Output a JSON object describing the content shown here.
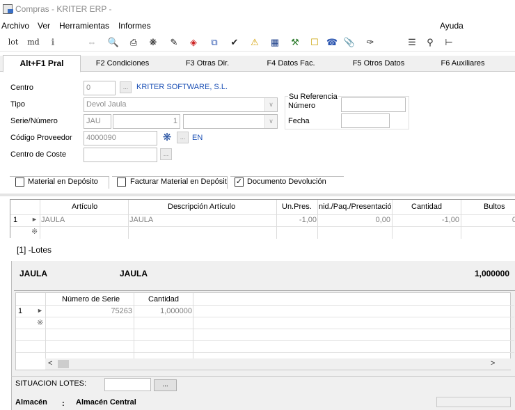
{
  "window": {
    "title": "Compras - KRITER ERP -"
  },
  "menu": {
    "archivo": "Archivo",
    "ver": "Ver",
    "herramientas": "Herramientas",
    "informes": "Informes",
    "ayuda": "Ayuda"
  },
  "toolbar": {
    "lot": "lot",
    "md": "md"
  },
  "tabs": [
    {
      "label": "Alt+F1 Pral"
    },
    {
      "label": "F2 Condiciones"
    },
    {
      "label": "F3 Otras Dir."
    },
    {
      "label": "F4 Datos Fac."
    },
    {
      "label": "F5 Otros Datos"
    },
    {
      "label": "F6 Auxiliares"
    }
  ],
  "form": {
    "centro_label": "Centro",
    "centro_value": "0",
    "centro_name": "KRITER SOFTWARE, S.L.",
    "tipo_label": "Tipo",
    "tipo_value": "Devol Jaula",
    "serie_label": "Serie/Número",
    "serie_value": "JAU",
    "numero_value": "1",
    "proveedor_label": "Código Proveedor",
    "proveedor_value": "4000090",
    "proveedor_lang": "EN",
    "coste_label": "Centro de Coste",
    "ref_title": "Su Referencia",
    "ref_numero_label": "Número",
    "ref_fecha_label": "Fecha"
  },
  "checks": {
    "material_deposito": {
      "label": "Material en Depósito",
      "checked": false
    },
    "facturar_deposito": {
      "label": "Facturar Material en Depósit",
      "checked": false
    },
    "documento_devolucion": {
      "label": "Documento Devolución",
      "checked": true
    }
  },
  "lines_grid": {
    "headers": [
      "Artículo",
      "Descripción Artículo",
      "Un.Pres.",
      "nid./Paq./Presentació",
      "Cantidad",
      "Bultos"
    ],
    "rows": [
      {
        "num": "1",
        "articulo": "JAULA",
        "descripcion": "JAULA",
        "un_pres": "-1,00",
        "paq": "0,00",
        "cantidad": "-1,00",
        "bultos": "0"
      }
    ]
  },
  "lotes": {
    "title": "[1] -Lotes",
    "product_code": "JAULA",
    "product_desc": "JAULA",
    "product_qty": "1,000000",
    "headers": [
      "Número de Serie",
      "Cantidad"
    ],
    "rows": [
      {
        "num": "1",
        "serie": "75263",
        "cantidad": "1,000000"
      }
    ],
    "situacion_label": "SITUACION LOTES:",
    "situacion_btn": "...",
    "almacen_label": "Almacén",
    "almacen_sep": ":",
    "almacen_value": "Almacén Central"
  },
  "colors": {
    "link": "#1a4fb5",
    "panel": "#f0f0f0"
  }
}
